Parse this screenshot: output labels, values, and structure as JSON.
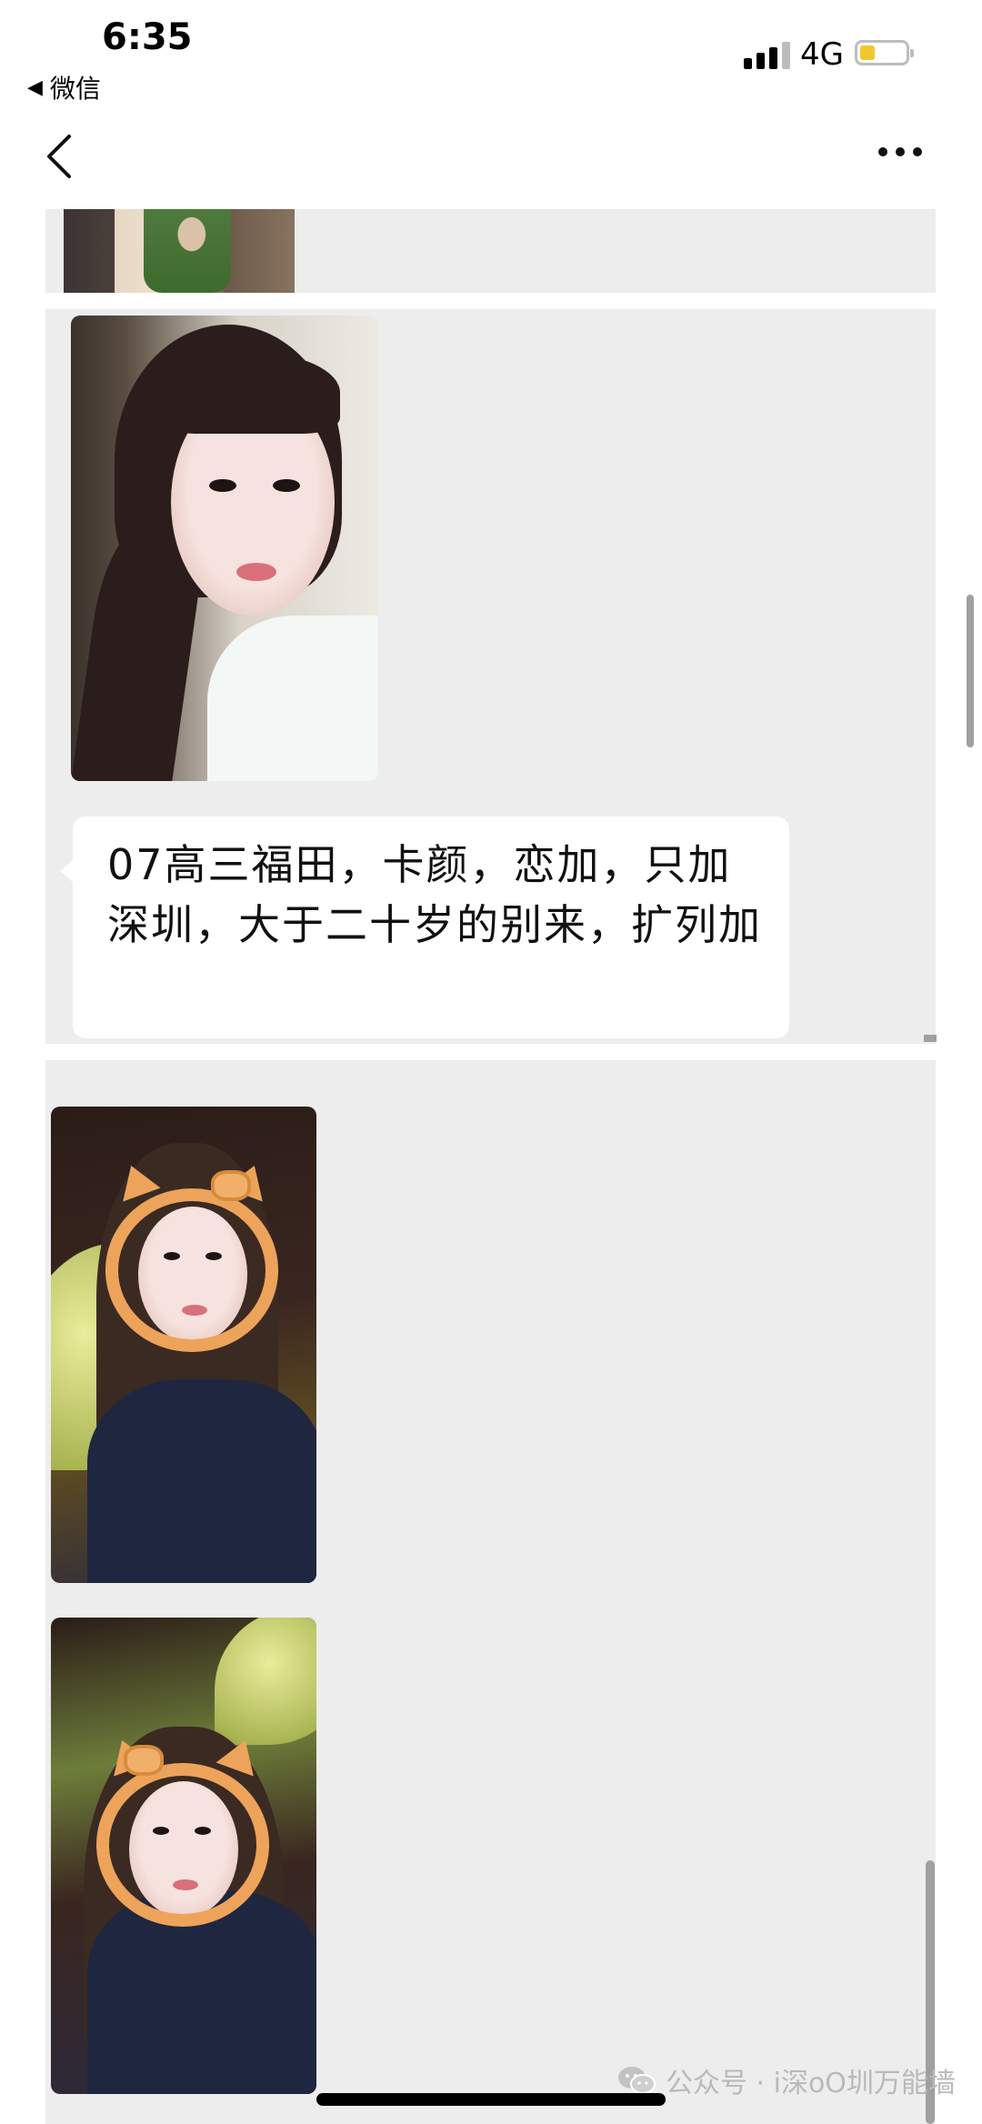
{
  "status_bar": {
    "time": "6:35",
    "back_app": "微信",
    "network": "4G",
    "battery_color": "#f2c62f"
  },
  "nav": {
    "back_icon": "chevron-left-icon",
    "more_icon": "more-dots-icon"
  },
  "chat": {
    "message": "07高三福田，卡颜，恋加，只加深圳，大于二十岁的别来，扩列加"
  },
  "watermark": {
    "text": "公众号 · i深oO圳万能墙"
  },
  "colors": {
    "panel_bg": "#ededed",
    "bubble_bg": "#ffffff"
  }
}
